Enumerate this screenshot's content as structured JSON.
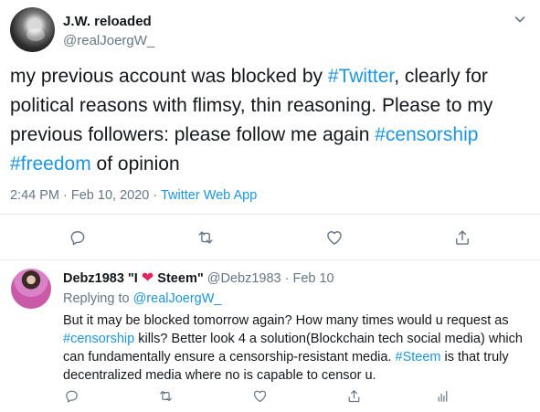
{
  "tweet": {
    "display_name": "J.W. reloaded",
    "handle": "@realJoergW_",
    "text_parts": [
      "my previous account was blocked by ",
      "#Twitter",
      ", clearly for political reasons with flimsy, thin reasoning. Please to my previous followers: please follow me again ",
      "#censorship",
      " ",
      "#freedom",
      " of opinion"
    ],
    "timestamp": "2:44 PM · Feb 10, 2020 · ",
    "app": "Twitter Web App",
    "icons": {
      "caret": "chevron-down-icon",
      "reply": "reply-icon",
      "retweet": "retweet-icon",
      "like": "heart-icon",
      "share": "share-icon"
    }
  },
  "reply": {
    "display_name_prefix": "Debz1983 \"I ",
    "display_name_suffix": " Steem\"",
    "heart": "❤",
    "handle": "@Debz1983",
    "separator": " · ",
    "date": "Feb 10",
    "replying_to_label": "Replying to ",
    "replying_to_mention": "@realJoergW_",
    "text_parts": [
      "But it may be blocked tomorrow again? How many times would u request as ",
      "#censorship",
      " kills? Better look 4 a solution(Blockchain tech social media) which can fundamentally ensure a censorship-resistant media. ",
      "#Steem",
      " is that truly decentralized media where no is capable to censor u."
    ],
    "icons": {
      "reply": "reply-icon",
      "retweet": "retweet-icon",
      "like": "heart-icon",
      "share": "share-icon",
      "analytics": "analytics-icon"
    }
  },
  "colors": {
    "link": "#1b95e0",
    "muted": "#657786",
    "text": "#14171a",
    "divider": "#e6ecf0",
    "heart": "#e0245e"
  }
}
